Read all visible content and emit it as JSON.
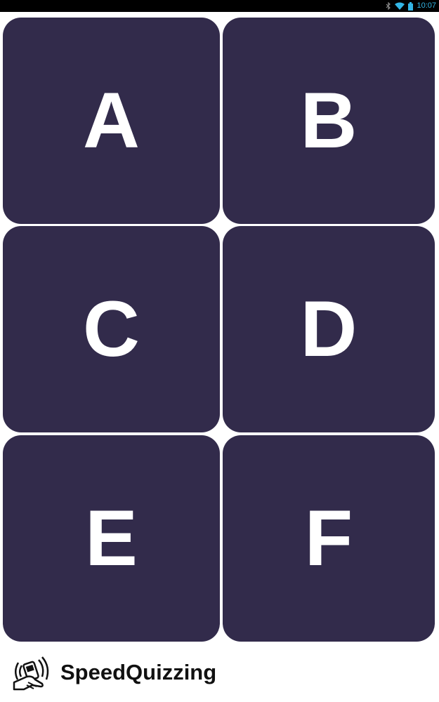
{
  "status_bar": {
    "time": "10:07",
    "icons": [
      "bluetooth-icon",
      "wifi-icon",
      "battery-icon"
    ],
    "accent_color": "#33b5e5"
  },
  "answers": [
    {
      "letter": "A"
    },
    {
      "letter": "B"
    },
    {
      "letter": "C"
    },
    {
      "letter": "D"
    },
    {
      "letter": "E"
    },
    {
      "letter": "F"
    }
  ],
  "tile_color": "#322b4b",
  "brand": {
    "name": "SpeedQuizzing",
    "logo_icon": "hands-with-buzzer-icon"
  }
}
